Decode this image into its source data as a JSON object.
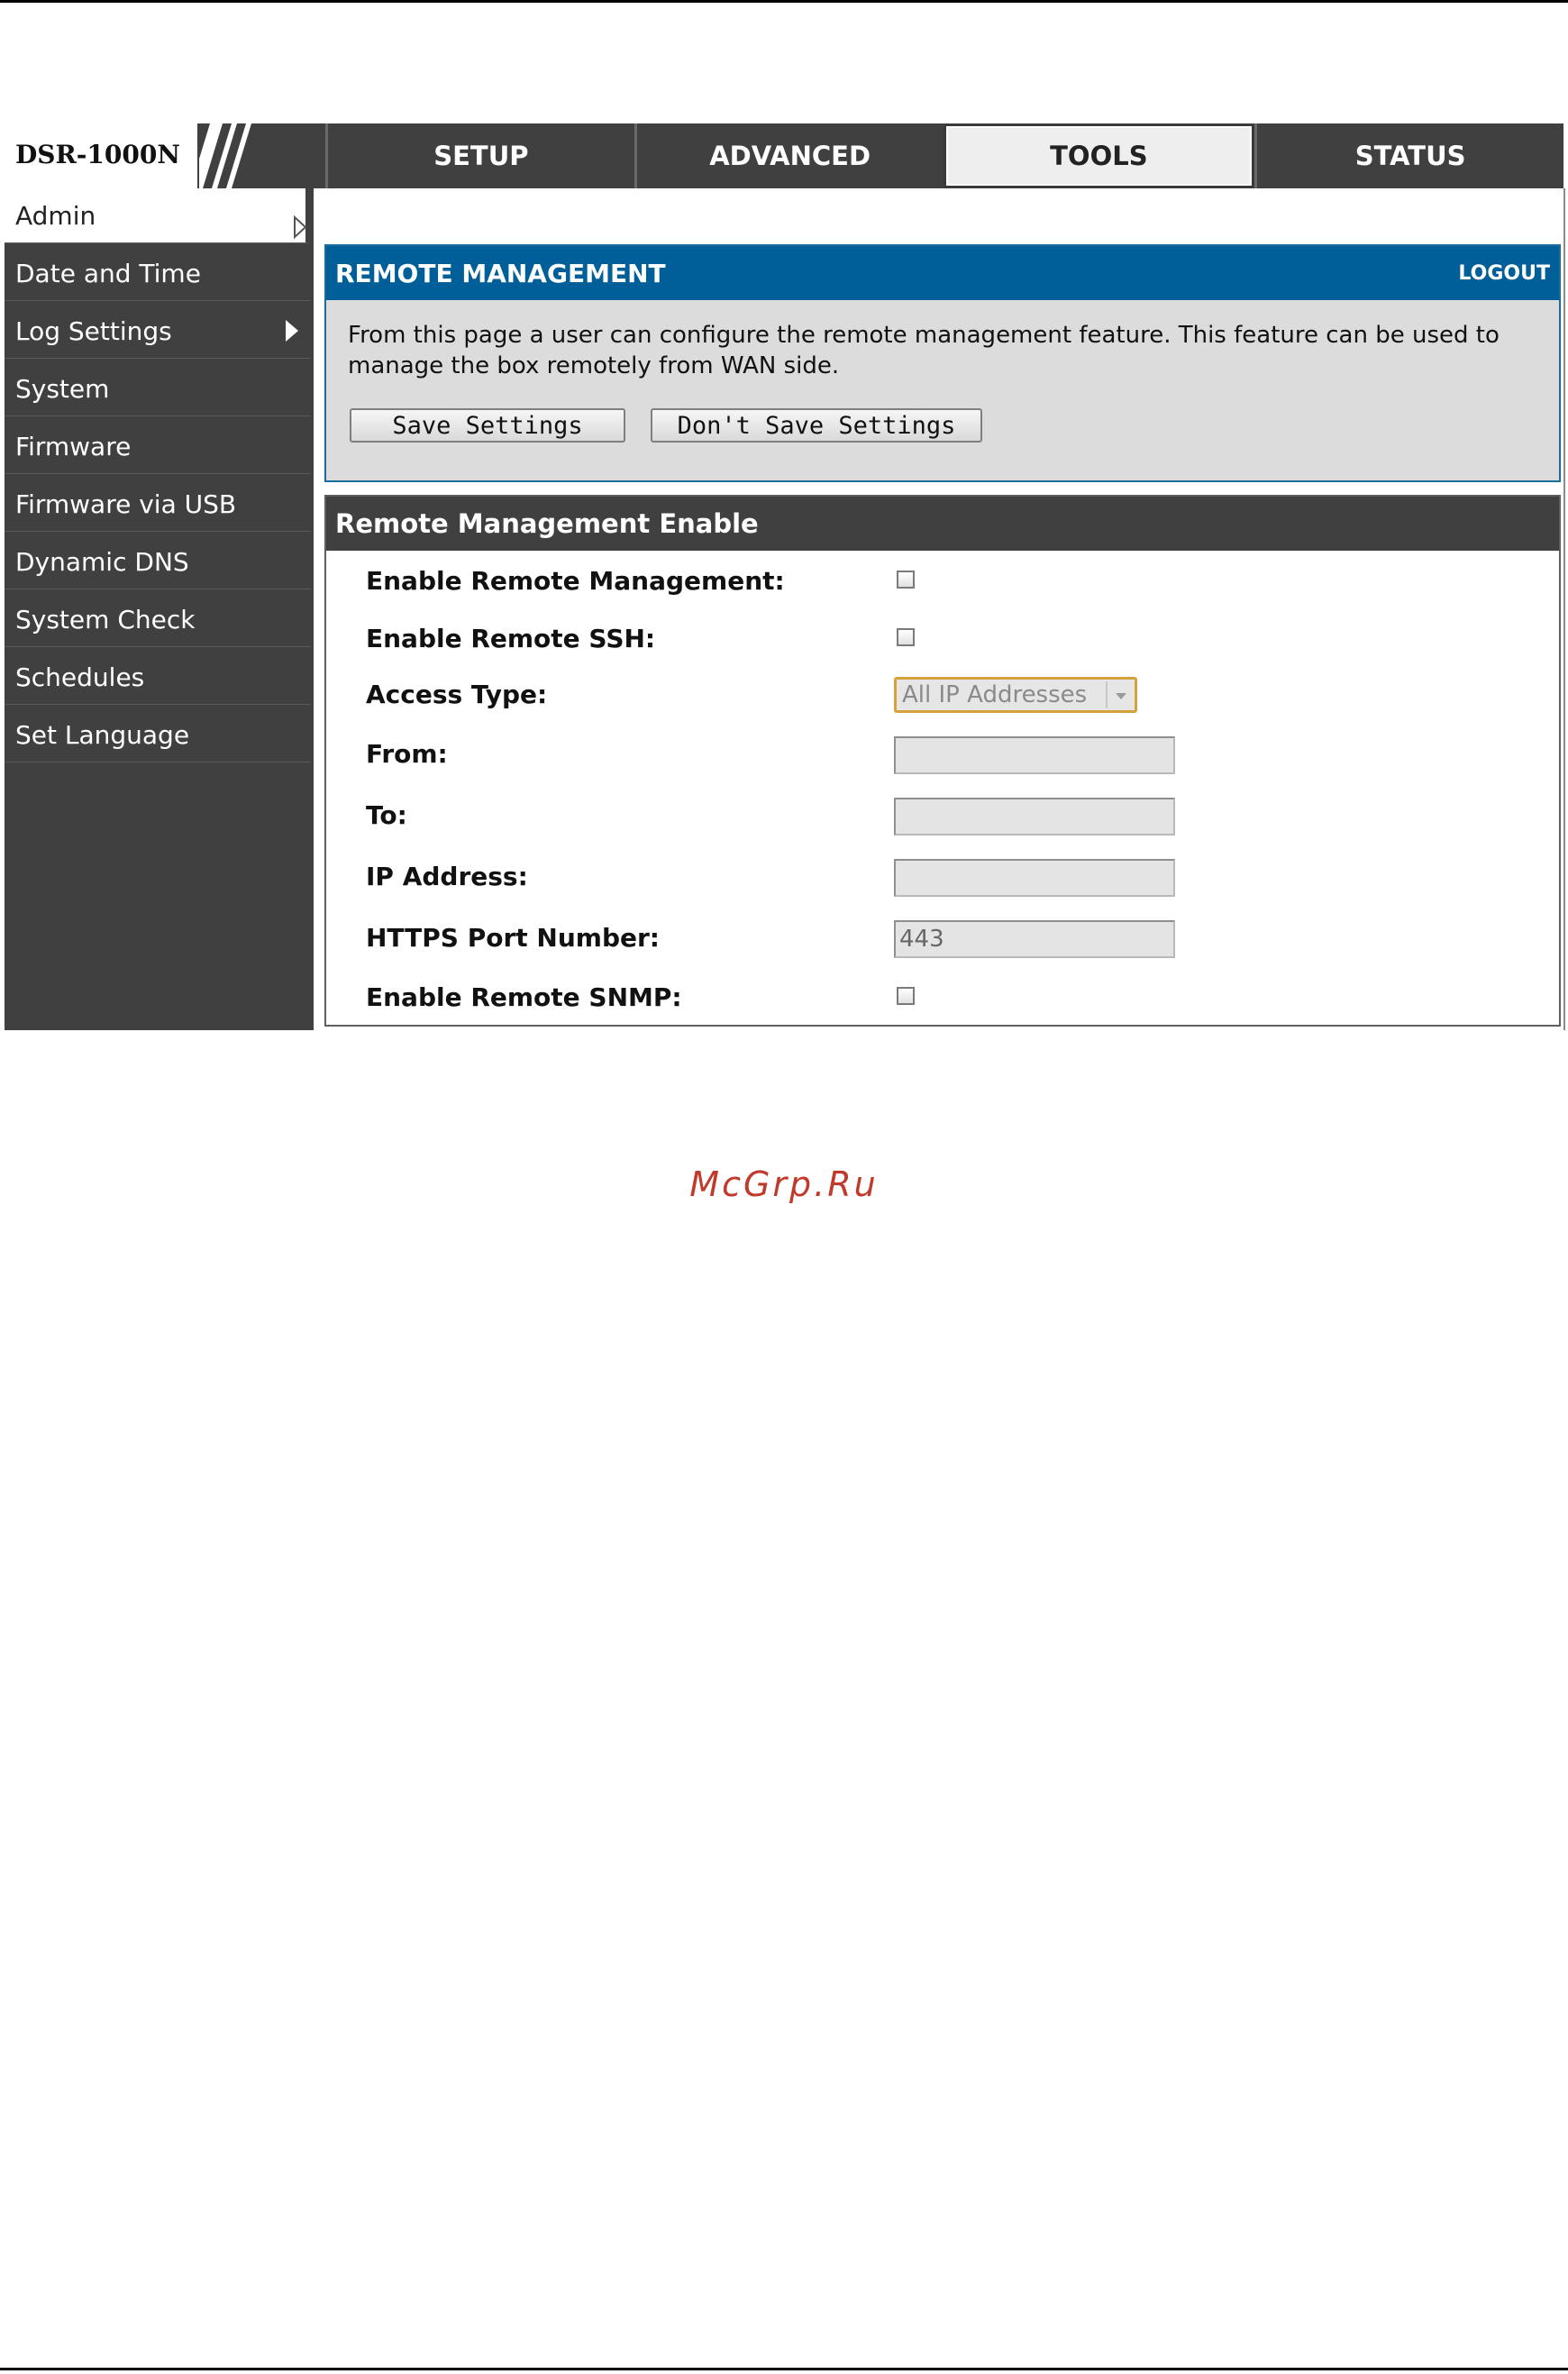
{
  "brand": "DSR-1000N",
  "nav": {
    "tabs": [
      {
        "label": "SETUP"
      },
      {
        "label": "ADVANCED"
      },
      {
        "label": "TOOLS",
        "active": true
      },
      {
        "label": "STATUS"
      }
    ]
  },
  "sidebar": {
    "items": [
      {
        "label": "Admin",
        "active": true,
        "arrow": "outline"
      },
      {
        "label": "Date and Time"
      },
      {
        "label": "Log Settings",
        "arrow": "solid"
      },
      {
        "label": "System"
      },
      {
        "label": "Firmware"
      },
      {
        "label": "Firmware via USB"
      },
      {
        "label": "Dynamic DNS"
      },
      {
        "label": "System Check"
      },
      {
        "label": "Schedules"
      },
      {
        "label": "Set Language"
      }
    ]
  },
  "remote_management": {
    "title": "REMOTE MANAGEMENT",
    "logout": "LOGOUT",
    "description": "From this page a user can configure the remote management feature. This feature can be used to manage the box remotely from WAN side.",
    "save_label": "Save Settings",
    "dont_save_label": "Don't Save Settings"
  },
  "section": {
    "title": "Remote Management Enable",
    "fields": {
      "enable_remote_management": {
        "label": "Enable Remote Management:",
        "checked": false
      },
      "enable_remote_ssh": {
        "label": "Enable Remote SSH:",
        "checked": false
      },
      "access_type": {
        "label": "Access Type:",
        "value": "All IP Addresses"
      },
      "from": {
        "label": "From:",
        "value": ""
      },
      "to": {
        "label": "To:",
        "value": ""
      },
      "ip_address": {
        "label": "IP Address:",
        "value": ""
      },
      "https_port": {
        "label": "HTTPS Port Number:",
        "value": "443"
      },
      "enable_remote_snmp": {
        "label": "Enable Remote SNMP:",
        "checked": false
      }
    }
  },
  "watermark": "McGrp.Ru",
  "colors": {
    "nav_bg": "#404040",
    "header_blue": "#005f99",
    "select_border": "#d4a13a",
    "watermark": "#c0392b"
  }
}
